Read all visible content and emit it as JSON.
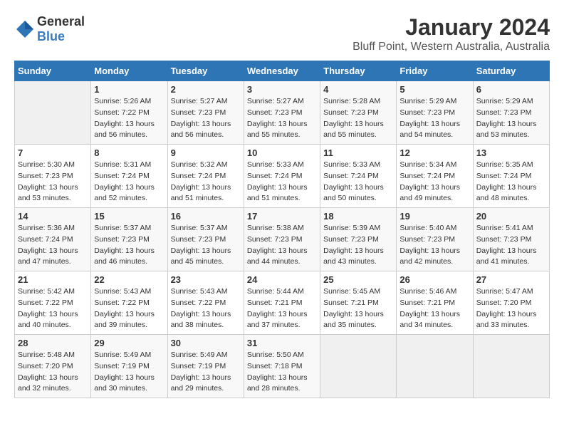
{
  "header": {
    "logo_general": "General",
    "logo_blue": "Blue",
    "month_title": "January 2024",
    "location": "Bluff Point, Western Australia, Australia"
  },
  "weekdays": [
    "Sunday",
    "Monday",
    "Tuesday",
    "Wednesday",
    "Thursday",
    "Friday",
    "Saturday"
  ],
  "days": [
    {
      "date": null,
      "sunrise": null,
      "sunset": null,
      "daylight": null
    },
    {
      "date": "1",
      "sunrise": "5:26 AM",
      "sunset": "7:22 PM",
      "daylight": "13 hours and 56 minutes."
    },
    {
      "date": "2",
      "sunrise": "5:27 AM",
      "sunset": "7:23 PM",
      "daylight": "13 hours and 56 minutes."
    },
    {
      "date": "3",
      "sunrise": "5:27 AM",
      "sunset": "7:23 PM",
      "daylight": "13 hours and 55 minutes."
    },
    {
      "date": "4",
      "sunrise": "5:28 AM",
      "sunset": "7:23 PM",
      "daylight": "13 hours and 55 minutes."
    },
    {
      "date": "5",
      "sunrise": "5:29 AM",
      "sunset": "7:23 PM",
      "daylight": "13 hours and 54 minutes."
    },
    {
      "date": "6",
      "sunrise": "5:29 AM",
      "sunset": "7:23 PM",
      "daylight": "13 hours and 53 minutes."
    },
    {
      "date": "7",
      "sunrise": "5:30 AM",
      "sunset": "7:23 PM",
      "daylight": "13 hours and 53 minutes."
    },
    {
      "date": "8",
      "sunrise": "5:31 AM",
      "sunset": "7:24 PM",
      "daylight": "13 hours and 52 minutes."
    },
    {
      "date": "9",
      "sunrise": "5:32 AM",
      "sunset": "7:24 PM",
      "daylight": "13 hours and 51 minutes."
    },
    {
      "date": "10",
      "sunrise": "5:33 AM",
      "sunset": "7:24 PM",
      "daylight": "13 hours and 51 minutes."
    },
    {
      "date": "11",
      "sunrise": "5:33 AM",
      "sunset": "7:24 PM",
      "daylight": "13 hours and 50 minutes."
    },
    {
      "date": "12",
      "sunrise": "5:34 AM",
      "sunset": "7:24 PM",
      "daylight": "13 hours and 49 minutes."
    },
    {
      "date": "13",
      "sunrise": "5:35 AM",
      "sunset": "7:24 PM",
      "daylight": "13 hours and 48 minutes."
    },
    {
      "date": "14",
      "sunrise": "5:36 AM",
      "sunset": "7:24 PM",
      "daylight": "13 hours and 47 minutes."
    },
    {
      "date": "15",
      "sunrise": "5:37 AM",
      "sunset": "7:23 PM",
      "daylight": "13 hours and 46 minutes."
    },
    {
      "date": "16",
      "sunrise": "5:37 AM",
      "sunset": "7:23 PM",
      "daylight": "13 hours and 45 minutes."
    },
    {
      "date": "17",
      "sunrise": "5:38 AM",
      "sunset": "7:23 PM",
      "daylight": "13 hours and 44 minutes."
    },
    {
      "date": "18",
      "sunrise": "5:39 AM",
      "sunset": "7:23 PM",
      "daylight": "13 hours and 43 minutes."
    },
    {
      "date": "19",
      "sunrise": "5:40 AM",
      "sunset": "7:23 PM",
      "daylight": "13 hours and 42 minutes."
    },
    {
      "date": "20",
      "sunrise": "5:41 AM",
      "sunset": "7:23 PM",
      "daylight": "13 hours and 41 minutes."
    },
    {
      "date": "21",
      "sunrise": "5:42 AM",
      "sunset": "7:22 PM",
      "daylight": "13 hours and 40 minutes."
    },
    {
      "date": "22",
      "sunrise": "5:43 AM",
      "sunset": "7:22 PM",
      "daylight": "13 hours and 39 minutes."
    },
    {
      "date": "23",
      "sunrise": "5:43 AM",
      "sunset": "7:22 PM",
      "daylight": "13 hours and 38 minutes."
    },
    {
      "date": "24",
      "sunrise": "5:44 AM",
      "sunset": "7:21 PM",
      "daylight": "13 hours and 37 minutes."
    },
    {
      "date": "25",
      "sunrise": "5:45 AM",
      "sunset": "7:21 PM",
      "daylight": "13 hours and 35 minutes."
    },
    {
      "date": "26",
      "sunrise": "5:46 AM",
      "sunset": "7:21 PM",
      "daylight": "13 hours and 34 minutes."
    },
    {
      "date": "27",
      "sunrise": "5:47 AM",
      "sunset": "7:20 PM",
      "daylight": "13 hours and 33 minutes."
    },
    {
      "date": "28",
      "sunrise": "5:48 AM",
      "sunset": "7:20 PM",
      "daylight": "13 hours and 32 minutes."
    },
    {
      "date": "29",
      "sunrise": "5:49 AM",
      "sunset": "7:19 PM",
      "daylight": "13 hours and 30 minutes."
    },
    {
      "date": "30",
      "sunrise": "5:49 AM",
      "sunset": "7:19 PM",
      "daylight": "13 hours and 29 minutes."
    },
    {
      "date": "31",
      "sunrise": "5:50 AM",
      "sunset": "7:18 PM",
      "daylight": "13 hours and 28 minutes."
    }
  ],
  "labels": {
    "sunrise": "Sunrise:",
    "sunset": "Sunset:",
    "daylight": "Daylight:"
  }
}
